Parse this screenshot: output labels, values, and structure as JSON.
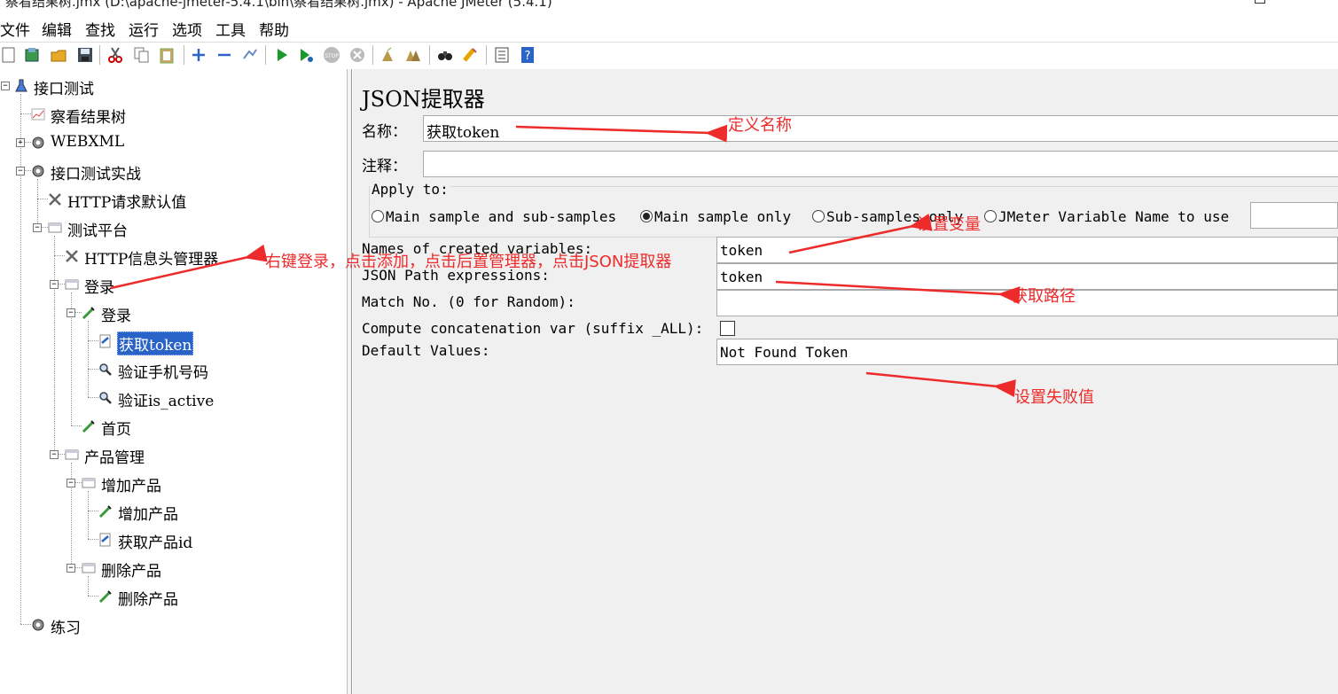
{
  "window": {
    "title": "察看结果树.jmx (D:\\apache-jmeter-5.4.1\\bin\\察看结果树.jmx) - Apache JMeter (5.4.1)"
  },
  "menu": [
    "文件",
    "编辑",
    "查找",
    "运行",
    "选项",
    "工具",
    "帮助"
  ],
  "tree": {
    "root": "接口测试",
    "result_tree": "察看结果树",
    "webxml": "WEBXML",
    "combat": "接口测试实战",
    "http_defaults": "HTTP请求默认值",
    "platform": "测试平台",
    "header_manager": "HTTP信息头管理器",
    "login_ctrl": "登录",
    "login_sampler": "登录",
    "get_token": "获取token",
    "verify_phone": "验证手机号码",
    "verify_active": "验证is_active",
    "home": "首页",
    "product_mgmt": "产品管理",
    "add_product_ctrl": "增加产品",
    "add_product": "增加产品",
    "get_product_id": "获取产品id",
    "delete_product_ctrl": "删除产品",
    "delete_product": "删除产品",
    "practice": "练习"
  },
  "panel": {
    "title": "JSON提取器",
    "name_label": "名称：",
    "name_value": "获取token",
    "comment_label": "注释：",
    "comment_value": "",
    "apply_to_label": "Apply to:",
    "apply_options": [
      "Main sample and sub-samples",
      "Main sample only",
      "Sub-samples only",
      "JMeter Variable Name to use"
    ],
    "apply_selected": "Main sample only",
    "var_names_label": "Names of created variables:",
    "var_names_value": "token",
    "json_path_label": "JSON Path expressions:",
    "json_path_value": "token",
    "match_no_label": "Match No. (0 for Random):",
    "match_no_value": "",
    "concat_label": "Compute concatenation var (suffix _ALL):",
    "concat_checked": false,
    "default_label": "Default Values:",
    "default_value": "Not Found Token"
  },
  "annotations": {
    "define_name": "定义名称",
    "set_variable": "设置变量",
    "right_click_hint": "右键登录，点击添加，点击后置管理器，点击JSON提取器",
    "get_path": "获取路径",
    "set_fail_value": "设置失败值"
  },
  "colors": {
    "annotation": "#ee2b2b",
    "selection": "#2a63c7"
  }
}
